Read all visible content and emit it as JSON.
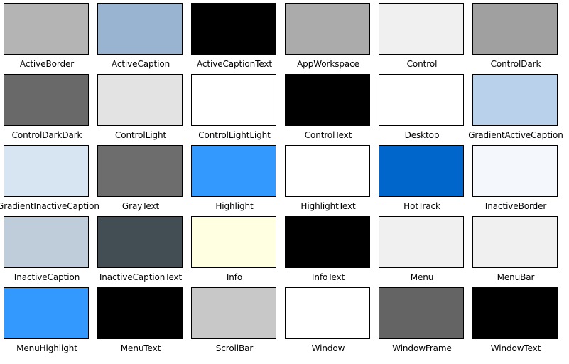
{
  "swatches": [
    {
      "name": "ActiveBorder",
      "color": "#b4b4b4"
    },
    {
      "name": "ActiveCaption",
      "color": "#99b4d1"
    },
    {
      "name": "ActiveCaptionText",
      "color": "#000000"
    },
    {
      "name": "AppWorkspace",
      "color": "#ababab"
    },
    {
      "name": "Control",
      "color": "#f0f0f0"
    },
    {
      "name": "ControlDark",
      "color": "#a0a0a0"
    },
    {
      "name": "ControlDarkDark",
      "color": "#696969"
    },
    {
      "name": "ControlLight",
      "color": "#e3e3e3"
    },
    {
      "name": "ControlLightLight",
      "color": "#ffffff"
    },
    {
      "name": "ControlText",
      "color": "#000000"
    },
    {
      "name": "Desktop",
      "color": "#ffffff"
    },
    {
      "name": "GradientActiveCaption",
      "color": "#b9d1ea"
    },
    {
      "name": "GradientInactiveCaption",
      "color": "#d7e4f2"
    },
    {
      "name": "GrayText",
      "color": "#6d6d6d"
    },
    {
      "name": "Highlight",
      "color": "#3399ff"
    },
    {
      "name": "HighlightText",
      "color": "#ffffff"
    },
    {
      "name": "HotTrack",
      "color": "#0066cc"
    },
    {
      "name": "InactiveBorder",
      "color": "#f4f7fc"
    },
    {
      "name": "InactiveCaption",
      "color": "#bfcddb"
    },
    {
      "name": "InactiveCaptionText",
      "color": "#434e54"
    },
    {
      "name": "Info",
      "color": "#ffffe1"
    },
    {
      "name": "InfoText",
      "color": "#000000"
    },
    {
      "name": "Menu",
      "color": "#f0f0f0"
    },
    {
      "name": "MenuBar",
      "color": "#f0f0f0"
    },
    {
      "name": "MenuHighlight",
      "color": "#3399ff"
    },
    {
      "name": "MenuText",
      "color": "#000000"
    },
    {
      "name": "ScrollBar",
      "color": "#c8c8c8"
    },
    {
      "name": "Window",
      "color": "#ffffff"
    },
    {
      "name": "WindowFrame",
      "color": "#646464"
    },
    {
      "name": "WindowText",
      "color": "#000000"
    }
  ]
}
